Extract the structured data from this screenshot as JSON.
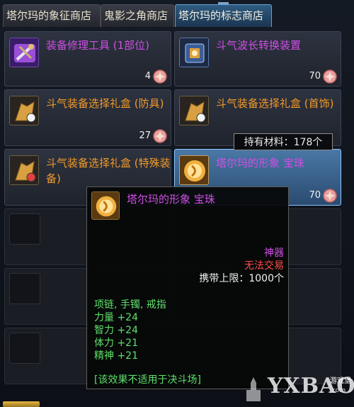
{
  "tabs": [
    {
      "label": "塔尔玛的象征商店"
    },
    {
      "label": "鬼影之角商店"
    },
    {
      "label": "塔尔玛的标志商店"
    }
  ],
  "items": [
    {
      "name": "装备修理工具 (1部位)",
      "price": "4",
      "color": "#cf4fe6"
    },
    {
      "name": "斗气波长转换装置",
      "price": "70",
      "color": "#cf4fe6"
    },
    {
      "name": "斗气装备选择礼盒 (防具)",
      "price": "27",
      "color": "#f39a2a"
    },
    {
      "name": "斗气装备选择礼盒 (首饰)",
      "price": "",
      "color": "#f39a2a"
    },
    {
      "name": "斗气装备选择礼盒 (特殊装备)",
      "price": "",
      "color": "#f39a2a"
    },
    {
      "name": "塔尔玛的形象  宝珠",
      "price": "70",
      "color": "#cf4fe6"
    }
  ],
  "material": {
    "label": "持有材料：178个"
  },
  "tooltip": {
    "title": "塔尔玛的形象  宝珠",
    "rarity": "神器",
    "trade": "无法交易",
    "carry_limit": "携带上限：1000个",
    "slots": "项链, 手镯, 戒指",
    "stats": [
      "力量 +24",
      "智力 +24",
      "体力 +21",
      "精神 +21"
    ],
    "note": "[该效果不适用于决斗场]"
  },
  "watermark": {
    "main": "YXBAO",
    "small": "游戏堡",
    "url": ".com"
  },
  "colors": {
    "purple": "#cf4fe6",
    "orange": "#f39a2a",
    "green": "#5ee06a",
    "red": "#ff4b4b",
    "selected": "#4a78a6"
  }
}
